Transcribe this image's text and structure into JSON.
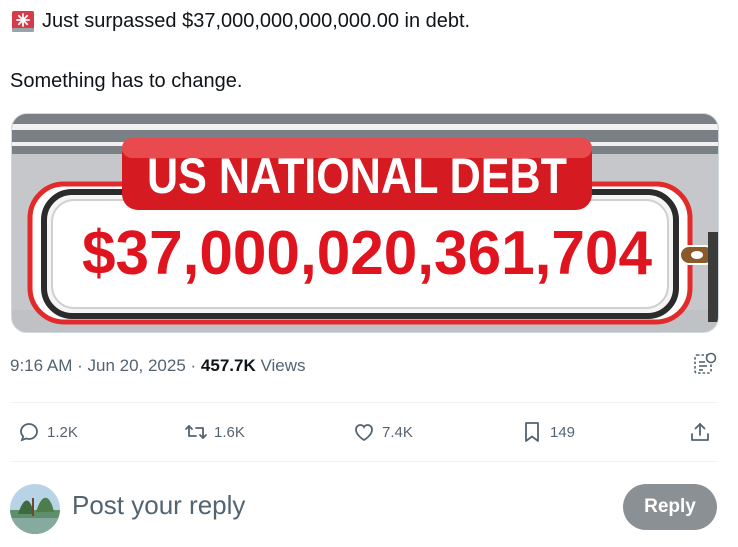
{
  "tweet": {
    "line1": "Just surpassed $37,000,000,000,000.00 in debt.",
    "line2": "Something has to change."
  },
  "media": {
    "banner_text": "US NATIONAL DEBT",
    "amount_text": "$37,000,020,361,704"
  },
  "meta": {
    "time": "9:16 AM",
    "separator1": " · ",
    "date": "Jun 20, 2025",
    "separator2": " · ",
    "views_count": "457.7K",
    "views_label": "Views"
  },
  "actions": {
    "replies": "1.2K",
    "reposts": "1.6K",
    "likes": "7.4K",
    "bookmarks": "149"
  },
  "reply": {
    "placeholder": "Post your reply",
    "button_label": "Reply"
  },
  "colors": {
    "accent_red": "#e0141f",
    "muted_text": "#536471",
    "reply_button": "#8b9095"
  },
  "icons": [
    "siren-emoji-icon",
    "analytics-icon",
    "reply-icon",
    "repost-icon",
    "like-icon",
    "bookmark-icon",
    "share-icon"
  ]
}
